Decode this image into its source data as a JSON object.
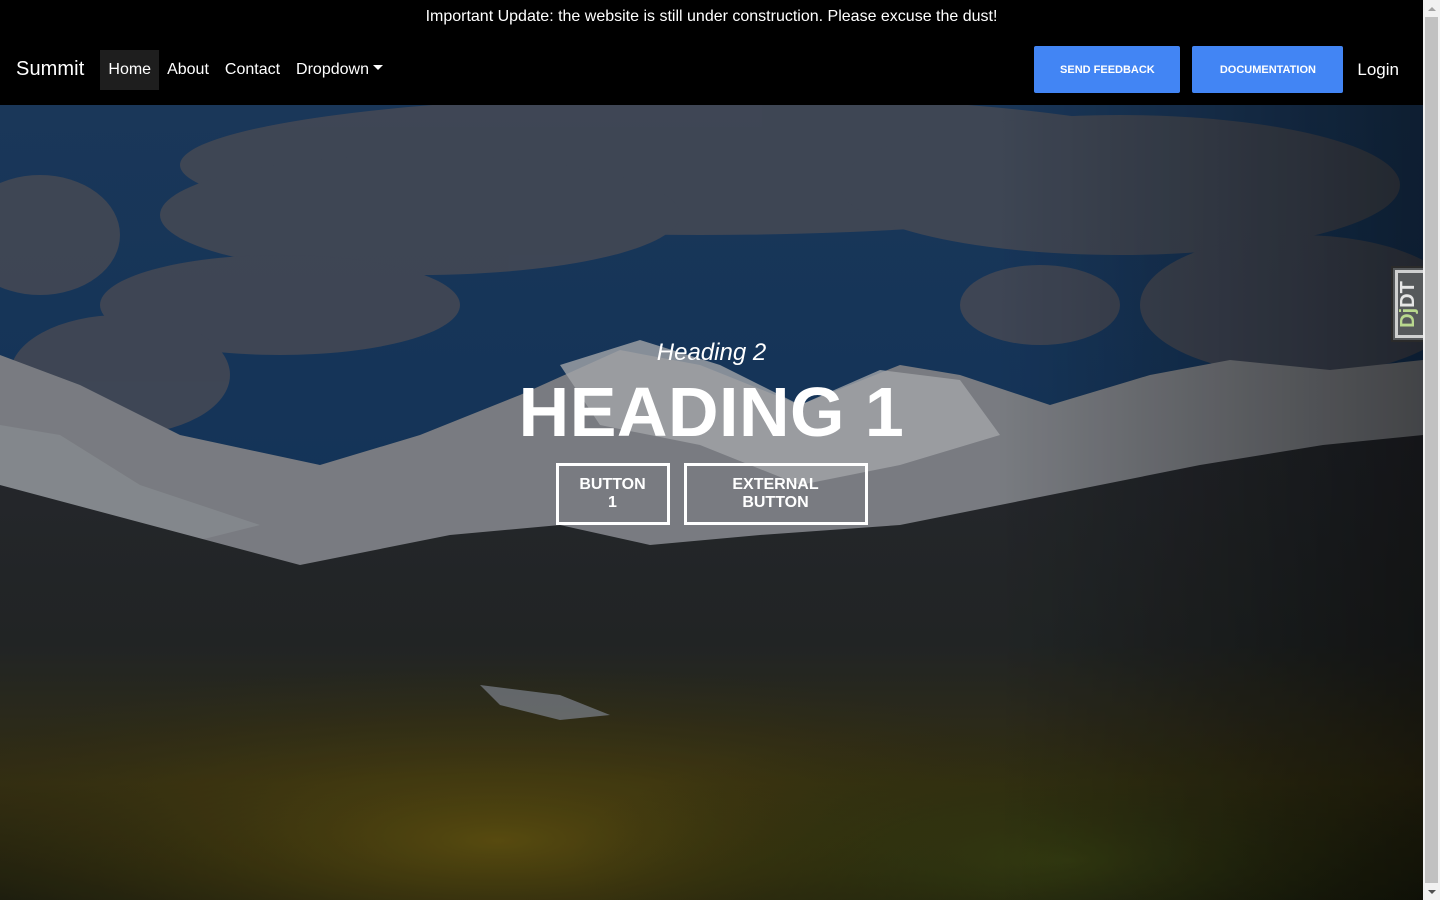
{
  "announcement": "Important Update: the website is still under construction. Please excuse the dust!",
  "navbar": {
    "brand": "Summit",
    "links": [
      {
        "label": "Home",
        "active": true
      },
      {
        "label": "About",
        "active": false
      },
      {
        "label": "Contact",
        "active": false
      },
      {
        "label": "Dropdown",
        "active": false,
        "dropdown": true
      }
    ],
    "buttons": {
      "feedback": "SEND FEEDBACK",
      "documentation": "DOCUMENTATION"
    },
    "login": "Login"
  },
  "hero": {
    "heading2": "Heading 2",
    "heading1": "HEADING 1",
    "button1": "BUTTON 1",
    "external_button": "EXTERNAL BUTTON"
  },
  "debug_toolbar": {
    "prefix": "Dj",
    "suffix": "DT"
  },
  "colors": {
    "accent": "#4285f4",
    "navbar_bg": "#000000",
    "active_link_bg": "#1e1e1e"
  }
}
